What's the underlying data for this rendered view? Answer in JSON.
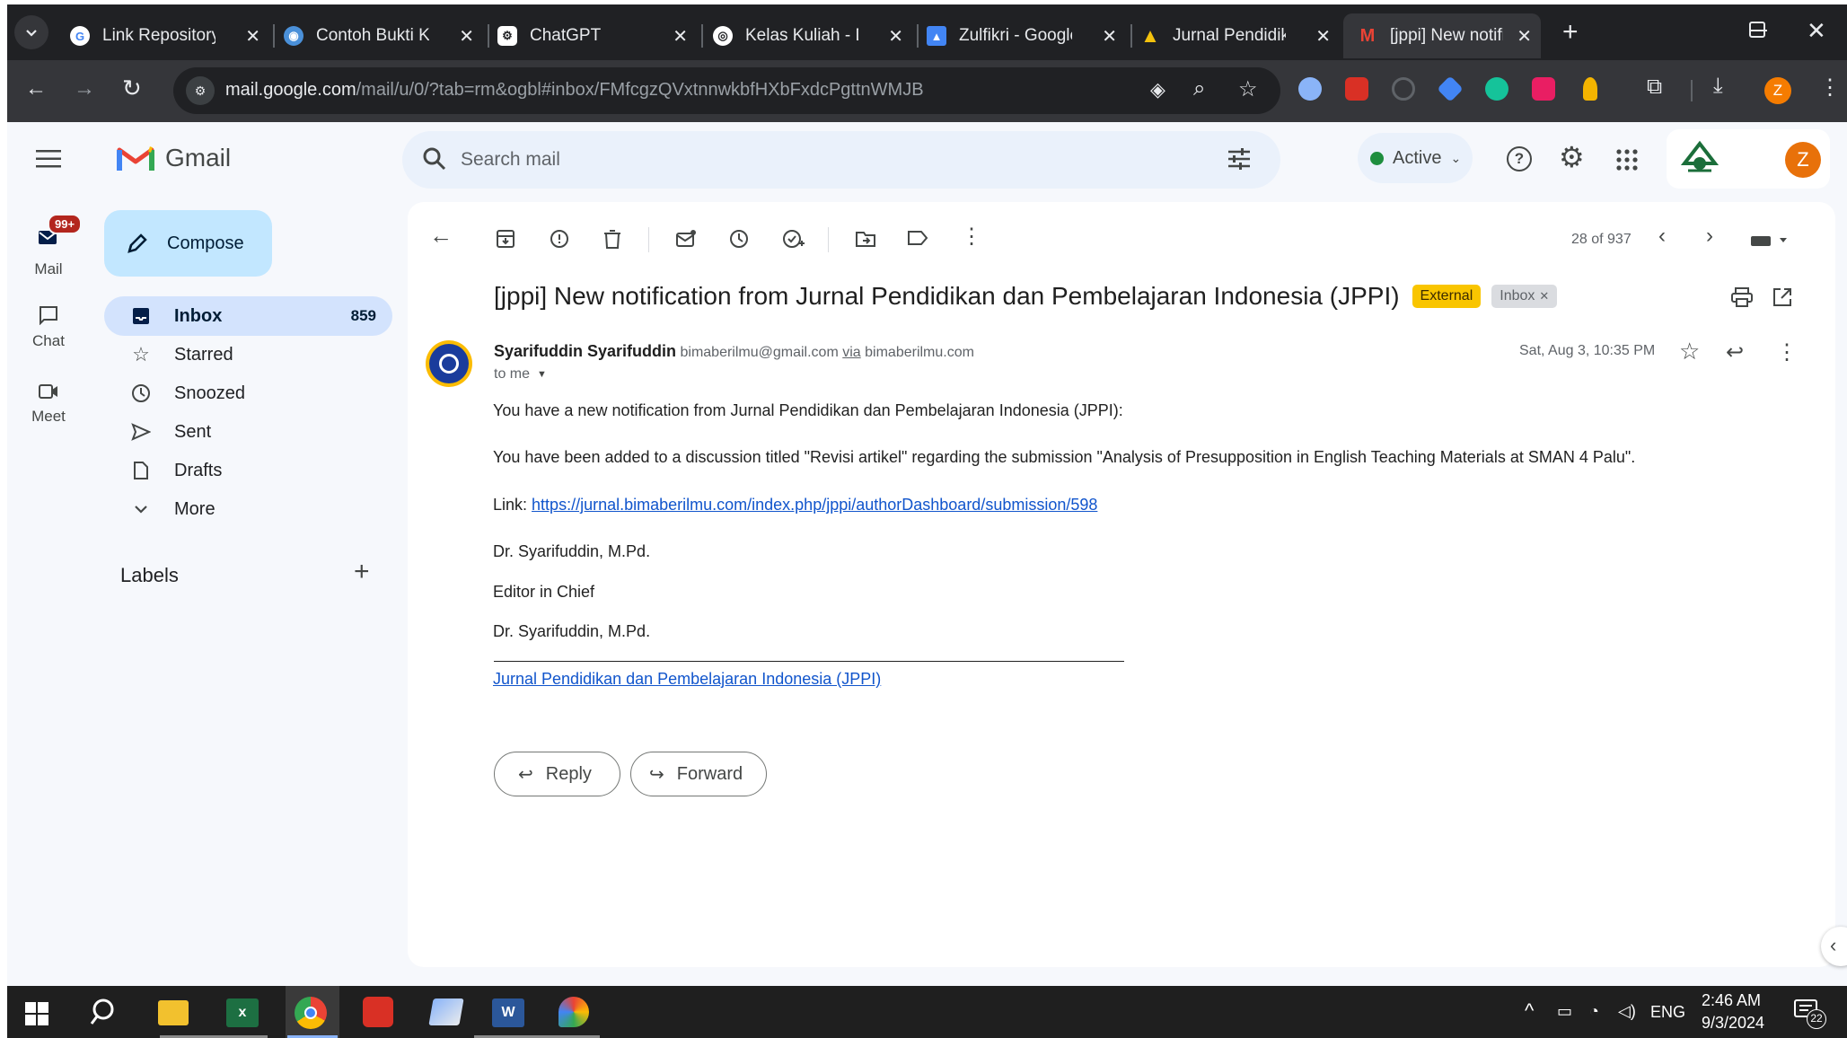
{
  "browser": {
    "tabs": [
      {
        "title": "Link Repository I",
        "icon": "google-icon"
      },
      {
        "title": "Contoh Bukti Ko",
        "icon": "globe-icon"
      },
      {
        "title": "ChatGPT",
        "icon": "chatgpt-icon"
      },
      {
        "title": "Kelas Kuliah - D",
        "icon": "compass-icon"
      },
      {
        "title": "Zulfikri - Google",
        "icon": "scholar-icon"
      },
      {
        "title": "Jurnal Pendidika",
        "icon": "warning-icon"
      },
      {
        "title": "[jppi] New notifi",
        "icon": "gmail-icon",
        "active": true
      }
    ],
    "url_domain": "mail.google.com",
    "url_path": "/mail/u/0/?tab=rm&ogbl#inbox/FMfcgzQVxtnnwkbfHXbFxdcPgttnWMJB",
    "profile_initial": "Z"
  },
  "gmail": {
    "app_name": "Gmail",
    "search_placeholder": "Search mail",
    "status": "Active",
    "account_initial": "Z",
    "rail": {
      "mail_label": "Mail",
      "mail_badge": "99+",
      "chat_label": "Chat",
      "meet_label": "Meet"
    },
    "compose_label": "Compose",
    "nav": [
      {
        "label": "Inbox",
        "count": "859",
        "icon": "inbox-icon"
      },
      {
        "label": "Starred",
        "count": "",
        "icon": "star-icon"
      },
      {
        "label": "Snoozed",
        "count": "",
        "icon": "clock-icon"
      },
      {
        "label": "Sent",
        "count": "",
        "icon": "send-icon"
      },
      {
        "label": "Drafts",
        "count": "",
        "icon": "draft-icon"
      },
      {
        "label": "More",
        "count": "",
        "icon": "chevron-down-icon"
      }
    ],
    "labels_heading": "Labels",
    "pagination": "28 of 937",
    "message": {
      "subject": "[jppi] New notification from Jurnal Pendidikan dan Pembelajaran Indonesia (JPPI)",
      "tag_external": "External",
      "tag_inbox": "Inbox",
      "sender_name": "Syarifuddin Syarifuddin",
      "sender_email": "bimaberilmu@gmail.com",
      "via_word": "via",
      "via_domain": "bimaberilmu.com",
      "date": "Sat, Aug 3, 10:35 PM",
      "to": "to me",
      "body_line1": "You have a new notification from Jurnal Pendidikan dan Pembelajaran Indonesia (JPPI):",
      "body_line2": "You have been added to a discussion titled \"Revisi artikel\" regarding the submission \"Analysis of Presupposition in English Teaching Materials at SMAN 4 Palu\".",
      "link_prefix": "Link:",
      "link_url": "https://jurnal.bimaberilmu.com/index.php/jppi/authorDashboard/submission/598",
      "sig_name1": "Dr. Syarifuddin, M.Pd.",
      "sig_title": "Editor in Chief",
      "sig_name2": "Dr. Syarifuddin, M.Pd.",
      "footer_link": "Jurnal Pendidikan dan Pembelajaran Indonesia (JPPI)"
    },
    "reply_label": "Reply",
    "forward_label": "Forward"
  },
  "taskbar": {
    "lang": "ENG",
    "time": "2:46 AM",
    "date": "9/3/2024",
    "notif_count": "22"
  }
}
